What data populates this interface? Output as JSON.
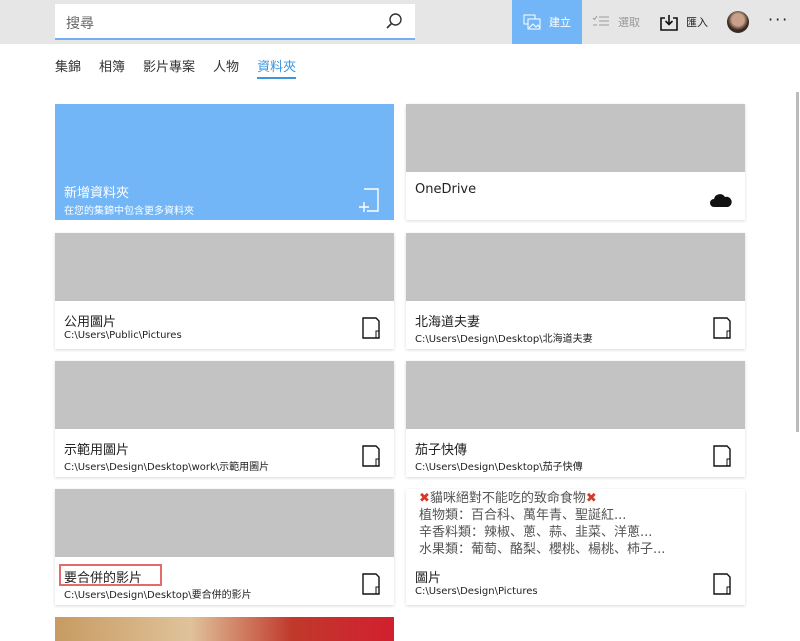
{
  "search": {
    "placeholder": "搜尋"
  },
  "toolbar": {
    "create": "建立",
    "select": "選取",
    "import": "匯入",
    "more": "···"
  },
  "tabs": [
    "集錦",
    "相簿",
    "影片專案",
    "人物",
    "資料夾"
  ],
  "cards": [
    {
      "title": "新增資料夾",
      "path": "在您的集錦中包含更多資料夾"
    },
    {
      "title": "OneDrive",
      "path": ""
    },
    {
      "title": "公用圖片",
      "path": "C:\\Users\\Public\\Pictures"
    },
    {
      "title": "北海道夫妻",
      "path": "C:\\Users\\Design\\Desktop\\北海道夫妻"
    },
    {
      "title": "示範用圖片",
      "path": "C:\\Users\\Design\\Desktop\\work\\示範用圖片"
    },
    {
      "title": "茄子快傳",
      "path": "C:\\Users\\Design\\Desktop\\茄子快傳"
    },
    {
      "title": "要合併的影片",
      "path": "C:\\Users\\Design\\Desktop\\要合併的影片"
    },
    {
      "title": "圖片",
      "path": "C:\\Users\\Design\\Pictures",
      "preview_lines": [
        "貓咪絕對不能吃的致命食物",
        "植物類：百合科、萬年青、聖誕紅...",
        "辛香料類：辣椒、蔥、蒜、韭菜、洋蔥...",
        "水果類：葡萄、酪梨、櫻桃、楊桃、柿子..."
      ]
    }
  ],
  "colors": {
    "accent": "#72b6f7",
    "tab_active": "#3a96dd",
    "highlight": "#e46b6b"
  }
}
